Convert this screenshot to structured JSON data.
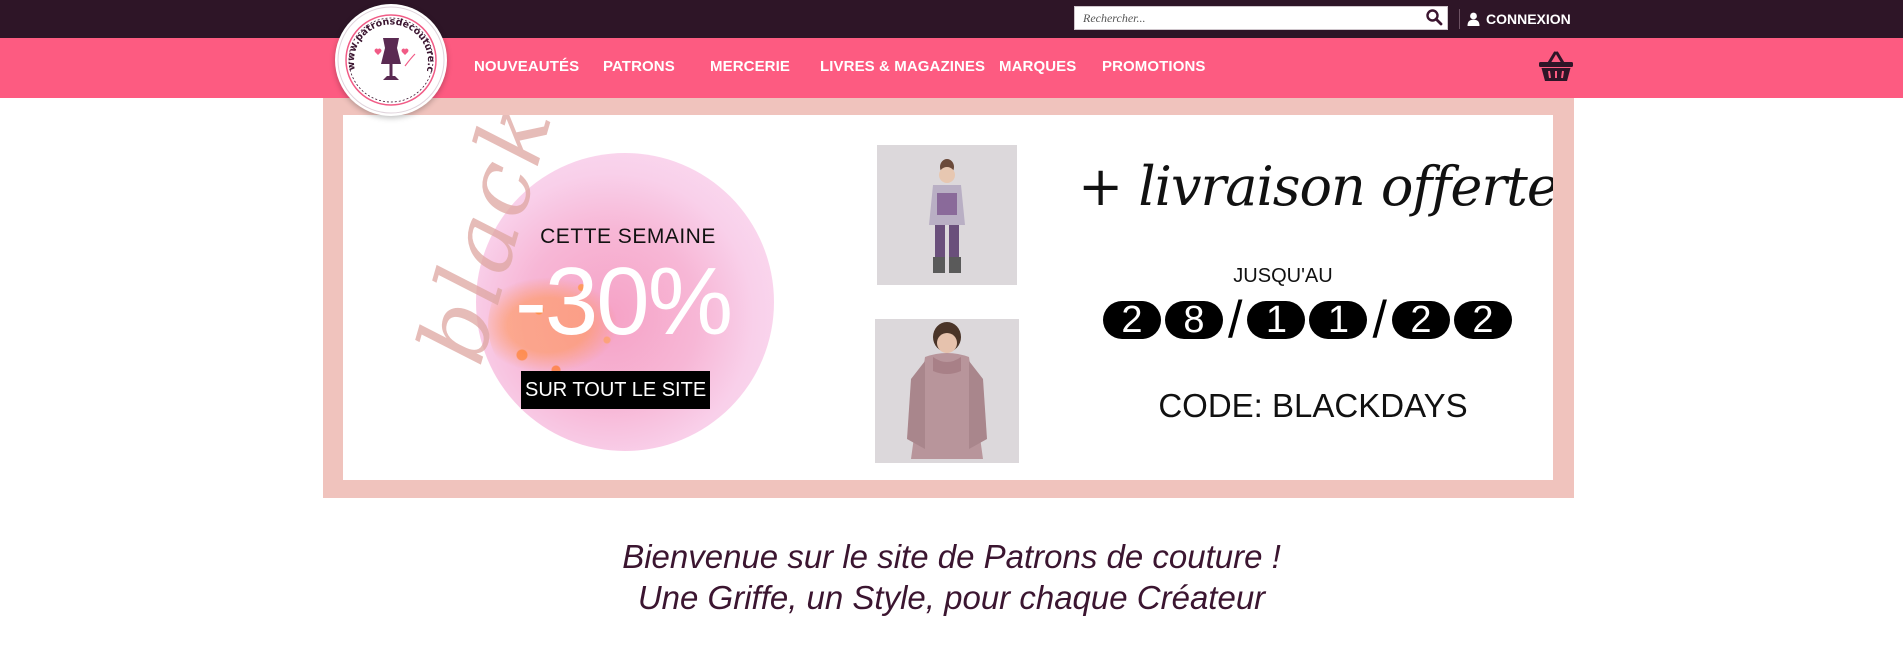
{
  "header": {
    "search": {
      "placeholder": "Rechercher...",
      "icon": "search-icon"
    },
    "login_label": "CONNEXION",
    "login_icon": "user-icon"
  },
  "logo": {
    "text": "www.patronsdecouture.com",
    "icon": "dress-form-icon"
  },
  "nav": {
    "items": [
      {
        "label": "NOUVEAUTÉS"
      },
      {
        "label": "PATRONS"
      },
      {
        "label": "MERCERIE"
      },
      {
        "label": "LIVRES & MAGAZINES"
      },
      {
        "label": "MARQUES"
      },
      {
        "label": "PROMOTIONS"
      }
    ],
    "cart_icon": "basket-icon"
  },
  "banner": {
    "script_word": "blackdays",
    "subtitle": "CETTE SEMAINE",
    "discount": "-30%",
    "scope": "SUR TOUT LE SITE",
    "shipping": "+ livraison offerte",
    "until_label": "JUSQU'AU",
    "date_digits": [
      "2",
      "8",
      "1",
      "1",
      "2",
      "2"
    ],
    "date_separator": "/",
    "code": "CODE: BLACKDAYS"
  },
  "welcome": {
    "line1": "Bienvenue sur le site de Patrons de couture !",
    "line2": "Une Griffe, un Style, pour chaque Créateur"
  },
  "colors": {
    "topbar": "#2e1527",
    "nav": "#fd5b81",
    "banner_frame": "#f0c3bd",
    "welcome_text": "#3b1530"
  }
}
